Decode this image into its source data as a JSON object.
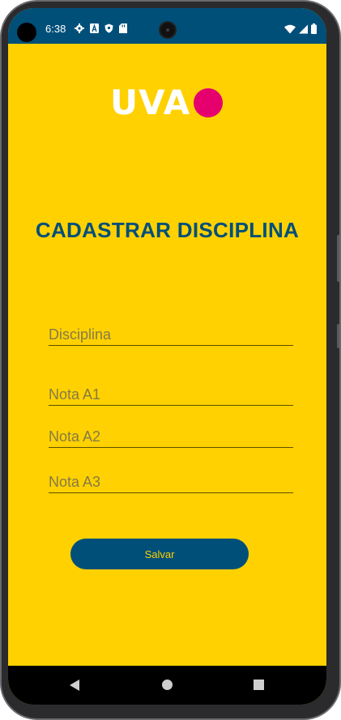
{
  "status_bar": {
    "time": "6:38",
    "icons_left": [
      "gear-icon",
      "a-badge-icon",
      "shield-icon",
      "sd-card-icon"
    ],
    "icons_right": [
      "wifi-icon",
      "signal-icon",
      "battery-icon"
    ],
    "color": "#004f79"
  },
  "logo": {
    "text": "UVA",
    "dot_color": "#e5006d"
  },
  "page": {
    "title": "CADASTRAR DISCIPLINA",
    "background_color": "#ffd100",
    "accent_color": "#004f79"
  },
  "form": {
    "disciplina_placeholder": "Disciplina",
    "disciplina_value": "",
    "nota_a1_placeholder": "Nota A1",
    "nota_a1_value": "",
    "nota_a2_placeholder": "Nota A2",
    "nota_a2_value": "",
    "nota_a3_placeholder": "Nota A3",
    "nota_a3_value": "",
    "save_label": "Salvar"
  },
  "nav_bar": {
    "buttons": [
      "back-icon",
      "home-icon",
      "recents-icon"
    ]
  }
}
